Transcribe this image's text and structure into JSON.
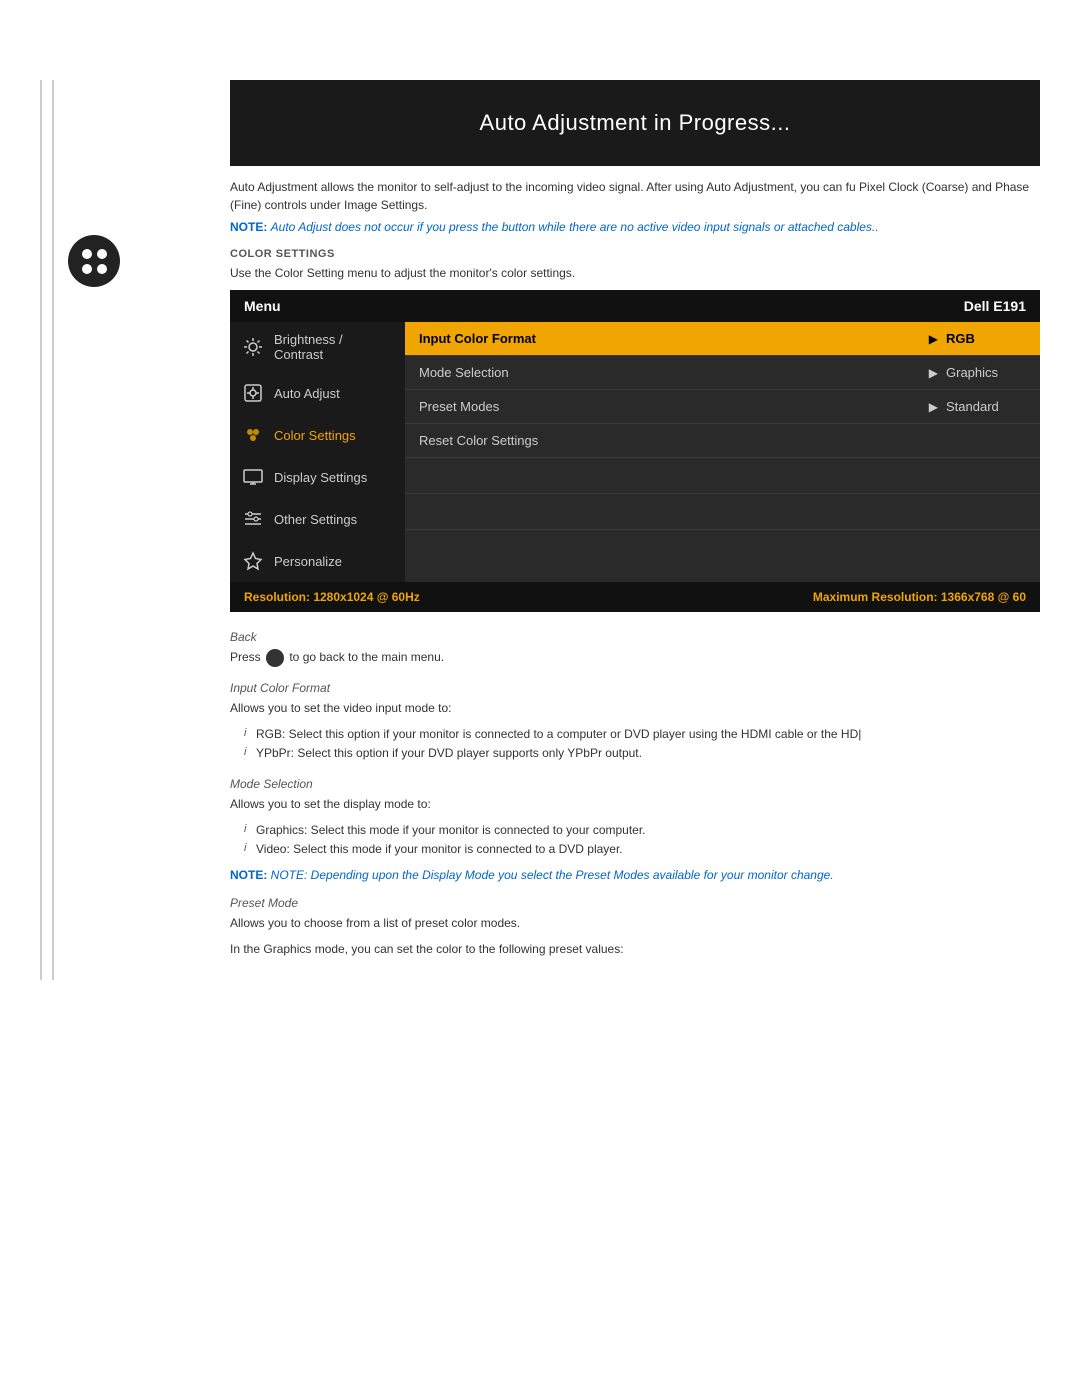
{
  "banner": {
    "title": "Auto Adjustment in Progress...",
    "description": "Auto Adjustment allows the monitor to self-adjust to the incoming video signal. After using Auto Adjustment, you can fu Pixel Clock (Coarse) and Phase (Fine) controls under Image Settings.",
    "note": "NOTE: Auto Adjust does not occur if you press the button while there are no active video input signals or attached cables.."
  },
  "color_settings_section": {
    "label": "COLOR SETTINGS",
    "description": "Use the Color Setting menu to adjust the monitor's color settings."
  },
  "osd": {
    "header_left": "Menu",
    "header_right": "Dell E191",
    "nav_items": [
      {
        "label": "Brightness / Contrast",
        "icon": "sun"
      },
      {
        "label": "Auto Adjust",
        "icon": "auto"
      },
      {
        "label": "Color Settings",
        "icon": "color",
        "active": true
      },
      {
        "label": "Display Settings",
        "icon": "display"
      },
      {
        "label": "Other Settings",
        "icon": "settings"
      },
      {
        "label": "Personalize",
        "icon": "star"
      }
    ],
    "right_rows": [
      {
        "label": "Input Color Format",
        "arrow": true,
        "value": "RGB",
        "highlighted": true
      },
      {
        "label": "Mode Selection",
        "arrow": true,
        "value": "Graphics",
        "highlighted": false
      },
      {
        "label": "Preset Modes",
        "arrow": true,
        "value": "Standard",
        "highlighted": false
      },
      {
        "label": "Reset Color Settings",
        "arrow": false,
        "value": "",
        "highlighted": false
      },
      {
        "label": "",
        "arrow": false,
        "value": "",
        "highlighted": false
      },
      {
        "label": "",
        "arrow": false,
        "value": "",
        "highlighted": false
      },
      {
        "label": "",
        "arrow": false,
        "value": "",
        "highlighted": false
      }
    ],
    "footer_left": "Resolution: 1280x1024 @ 60Hz",
    "footer_right": "Maximum Resolution: 1366x768 @ 60"
  },
  "desc_back": {
    "label": "Back",
    "text": "Press  to go back to the main menu."
  },
  "desc_input_color": {
    "label": "Input Color Format",
    "text": "Allows you to set the video input mode to:",
    "bullets": [
      "RGB: Select this option if your monitor is connected to a computer or DVD player using the HDMI cable or the HD|",
      "YPbPr: Select this option if your DVD player supports only YPbPr output."
    ]
  },
  "desc_mode_selection": {
    "label": "Mode Selection",
    "text": "Allows you to set the display mode to:",
    "bullets": [
      "Graphics: Select this mode if your monitor is connected to your computer.",
      "Video: Select this mode if your monitor is connected to a DVD player."
    ],
    "note": "NOTE: Depending upon the Display Mode you select the Preset Modes available for your monitor change."
  },
  "desc_preset_mode": {
    "label": "Preset Mode",
    "text1": "Allows you to choose from a list of preset color modes.",
    "text2": "In the Graphics mode, you can set the color to the following preset values:"
  }
}
